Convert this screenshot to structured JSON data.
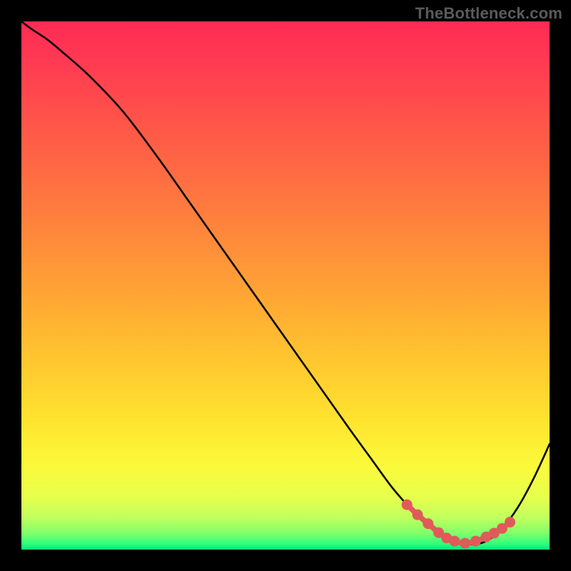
{
  "watermark": "TheBottleneck.com",
  "chart_data": {
    "type": "line",
    "title": "",
    "xlabel": "",
    "ylabel": "",
    "xlim": [
      0,
      100
    ],
    "ylim": [
      0,
      100
    ],
    "grid": false,
    "legend": false,
    "series": [
      {
        "name": "curve",
        "x": [
          0,
          2,
          5,
          8,
          12,
          16,
          20,
          26,
          32,
          38,
          44,
          50,
          56,
          62,
          66,
          70,
          73,
          76,
          79,
          82,
          85,
          88,
          91,
          94,
          97,
          100
        ],
        "y": [
          100,
          98.5,
          96.5,
          94,
          90.5,
          86.5,
          82,
          74,
          65.5,
          57,
          48.5,
          40,
          31.5,
          23,
          17.5,
          12,
          8.5,
          5.5,
          3.2,
          1.6,
          1.0,
          1.6,
          4.0,
          8.0,
          13.5,
          20
        ],
        "stroke": "#000000",
        "stroke_width": 2.6
      },
      {
        "name": "valley-marker",
        "x": [
          73,
          75,
          77,
          79,
          80.5,
          82,
          84,
          86,
          88,
          89.5,
          91,
          92.5
        ],
        "y": [
          8.5,
          6.6,
          4.9,
          3.2,
          2.2,
          1.6,
          1.2,
          1.6,
          2.4,
          3.1,
          4.0,
          5.2
        ],
        "stroke": "#e05a5a",
        "stroke_width": 7.5,
        "marker_radius": 7.5,
        "marker_fill": "#e05a5a"
      }
    ],
    "background_gradient": {
      "stops": [
        {
          "offset": 0.0,
          "color": "#ff2a55"
        },
        {
          "offset": 0.08,
          "color": "#ff3b52"
        },
        {
          "offset": 0.18,
          "color": "#ff5249"
        },
        {
          "offset": 0.3,
          "color": "#ff6e42"
        },
        {
          "offset": 0.42,
          "color": "#ff8c3a"
        },
        {
          "offset": 0.54,
          "color": "#ffab33"
        },
        {
          "offset": 0.66,
          "color": "#ffcb2f"
        },
        {
          "offset": 0.76,
          "color": "#ffe52f"
        },
        {
          "offset": 0.84,
          "color": "#fbf93a"
        },
        {
          "offset": 0.9,
          "color": "#e7ff4c"
        },
        {
          "offset": 0.94,
          "color": "#c0ff5d"
        },
        {
          "offset": 0.97,
          "color": "#7eff6b"
        },
        {
          "offset": 0.99,
          "color": "#2aff7d"
        },
        {
          "offset": 1.0,
          "color": "#00e57a"
        }
      ]
    }
  }
}
